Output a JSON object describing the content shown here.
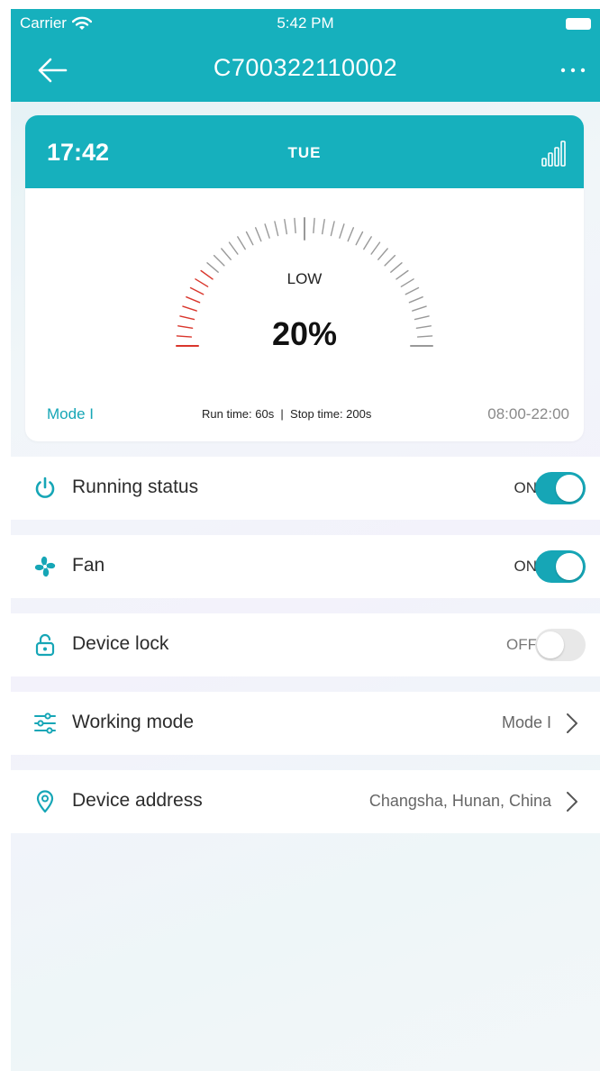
{
  "status_bar": {
    "carrier": "Carrier",
    "time": "5:42 PM"
  },
  "nav": {
    "title": "C700322110002"
  },
  "card": {
    "time": "17:42",
    "day": "TUE",
    "gauge": {
      "mode_label": "LOW",
      "value_label": "20%",
      "value_fraction": 0.2
    },
    "mode": "Mode I",
    "run_info": "Run time: 60s  |  Stop time: 200s",
    "schedule": "08:00-22:00"
  },
  "settings": {
    "running_status": {
      "label": "Running status",
      "state": "ON",
      "on": true
    },
    "fan": {
      "label": "Fan",
      "state": "ON",
      "on": true
    },
    "device_lock": {
      "label": "Device lock",
      "state": "OFF",
      "on": false
    },
    "working_mode": {
      "label": "Working mode",
      "value": "Mode I"
    },
    "device_address": {
      "label": "Device address",
      "value": "Changsha, Hunan, China"
    }
  },
  "colors": {
    "accent": "#16b0bd",
    "toggle_on": "#16a6b6",
    "gauge_active": "#d9362c",
    "gauge_inactive": "#999999"
  },
  "icons": {
    "back": "arrow-left-icon",
    "more": "more-horizontal-icon",
    "signal": "signal-bars-icon",
    "power": "power-icon",
    "fan": "fan-icon",
    "lock": "lock-icon",
    "mode": "sliders-icon",
    "location": "location-pin-icon",
    "chevron": "chevron-right-icon"
  }
}
